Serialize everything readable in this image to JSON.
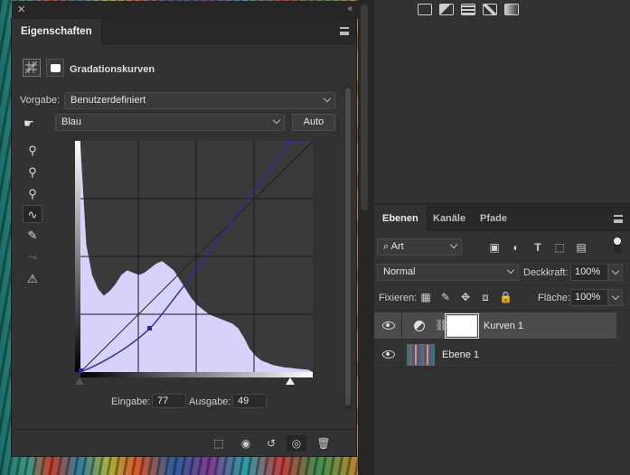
{
  "properties": {
    "tab_label": "Eigenschaften",
    "title": "Gradationskurven",
    "vorgabe_label": "Vorgabe:",
    "vorgabe_value": "Benutzerdefiniert",
    "channel_value": "Blau",
    "auto_label": "Auto",
    "tools": [
      "eyedropper-black-icon",
      "eyedropper-gray-icon",
      "eyedropper-white-icon",
      "curve-points-icon",
      "pencil-icon",
      "smooth-curve-icon",
      "clipping-warning-icon"
    ],
    "eingabe_label": "Eingabe:",
    "eingabe_value": "77",
    "ausgabe_label": "Ausgabe:",
    "ausgabe_value": "49",
    "curve_color": "#2a2aa8",
    "histogram_color": "#d7d2fb",
    "footer_buttons": [
      "clip-to-layer-icon",
      "view-previous-icon",
      "reset-icon",
      "visibility-icon",
      "trash-icon"
    ]
  },
  "layers": {
    "tabs": [
      {
        "label": "Ebenen",
        "active": true
      },
      {
        "label": "Kanäle",
        "active": false
      },
      {
        "label": "Pfade",
        "active": false
      }
    ],
    "filter_value": "Art",
    "blend_mode": "Normal",
    "deckkraft_label": "Deckkraft:",
    "deckkraft_value": "100%",
    "fixieren_label": "Fixieren:",
    "flaeche_label": "Fläche:",
    "flaeche_value": "100%",
    "items": [
      {
        "name": "Kurven 1",
        "selected": true
      },
      {
        "name": "Ebene 1",
        "selected": false
      }
    ]
  }
}
